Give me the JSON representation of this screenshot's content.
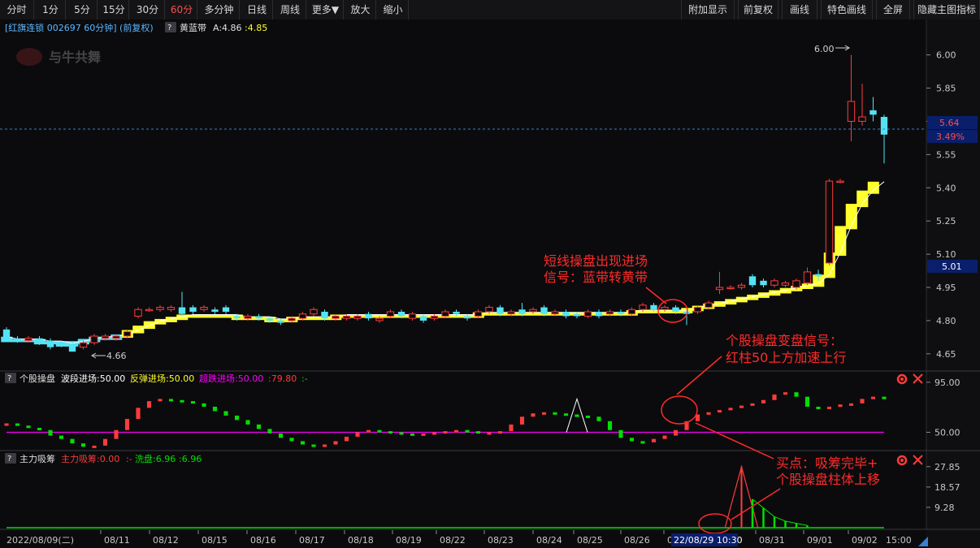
{
  "toolbar": {
    "left": [
      "分时",
      "1分",
      "5分",
      "15分",
      "30分",
      "60分",
      "多分钟",
      "日线",
      "周线",
      "更多▼",
      "放大",
      "缩小"
    ],
    "active": "60分",
    "right": [
      "附加显示",
      "前复权",
      "画线",
      "特色画线",
      "全屏",
      "隐藏主图指标"
    ]
  },
  "main_header": {
    "stock": "[红旗连锁 002697 60分钟] (前复权)",
    "question": "?",
    "indicator": "黄蓝带",
    "a_label": "A:4.86",
    "value": ":4.85"
  },
  "logo_text": "与牛共舞",
  "price_axis": {
    "ticks": [
      "6.00",
      "5.85",
      "5.70",
      "5.55",
      "5.40",
      "5.25",
      "5.10",
      "4.95",
      "4.80",
      "4.65"
    ],
    "current_price": "5.64",
    "current_change": "3.49%",
    "cursor_price": "5.01"
  },
  "annotations": {
    "high_label": "6.00",
    "low_label": "4.66",
    "note1_line1": "短线操盘出现进场",
    "note1_line2": "信号：蓝带转黄带",
    "note2_line1": "个股操盘变盘信号：",
    "note2_line2": "红柱50上方加速上行",
    "note3_line1": "买点：吸筹完毕+",
    "note3_line2": "个股操盘柱体上移"
  },
  "panel2": {
    "question": "?",
    "title": "个股操盘",
    "wave": "波段进场:50.00",
    "rebound": "反弹进场:50.00",
    "oversold": "超跌进场:50.00",
    "red_val": ":79.80",
    "dash": ":-",
    "ticks": [
      "95.00",
      "50.00"
    ]
  },
  "panel3": {
    "question": "?",
    "title": "主力吸筹",
    "main_label": "主力吸筹:0.00",
    "dash": ":-",
    "wash_label": "洗盘:6.96",
    "wash_val": ":6.96",
    "ticks": [
      "27.85",
      "18.57",
      "9.28"
    ]
  },
  "xaxis": {
    "labels": [
      "2022/08/09(二)",
      "08/11",
      "08/12",
      "08/15",
      "08/16",
      "08/17",
      "08/18",
      "08/19",
      "08/22",
      "08/23",
      "08/24",
      "08/25",
      "08/26",
      "0",
      "08/31",
      "09/01",
      "09/02",
      "15:00"
    ],
    "cursor_label": "22/08/29 10:30"
  },
  "colors": {
    "up": "#ff3b3b",
    "down": "#54e3f5",
    "yellow": "#ffff2b",
    "green": "#00e000",
    "magenta": "#ff00ff",
    "note": "#ff2a2a",
    "axis": "#c8c8c8"
  },
  "chart_data": {
    "type": "candlestick",
    "main_ylim": [
      4.62,
      6.05
    ],
    "candles": [
      [
        4.76,
        4.72,
        4.77,
        4.71
      ],
      [
        4.72,
        4.71,
        4.73,
        4.7
      ],
      [
        4.71,
        4.72,
        4.73,
        4.7
      ],
      [
        4.72,
        4.7,
        4.73,
        4.69
      ],
      [
        4.71,
        4.68,
        4.72,
        4.67
      ],
      [
        4.7,
        4.69,
        4.71,
        4.68
      ],
      [
        4.69,
        4.66,
        4.7,
        4.66
      ],
      [
        4.68,
        4.7,
        4.71,
        4.67
      ],
      [
        4.7,
        4.73,
        4.74,
        4.69
      ],
      [
        4.72,
        4.73,
        4.74,
        4.71
      ],
      [
        4.72,
        4.73,
        4.74,
        4.71
      ],
      [
        4.73,
        4.75,
        4.76,
        4.72
      ],
      [
        4.82,
        4.85,
        4.86,
        4.81
      ],
      [
        4.85,
        4.85,
        4.86,
        4.84
      ],
      [
        4.85,
        4.86,
        4.87,
        4.84
      ],
      [
        4.85,
        4.86,
        4.87,
        4.84
      ],
      [
        4.86,
        4.83,
        4.93,
        4.82
      ],
      [
        4.86,
        4.84,
        4.87,
        4.83
      ],
      [
        4.85,
        4.86,
        4.87,
        4.84
      ],
      [
        4.85,
        4.84,
        4.86,
        4.83
      ],
      [
        4.86,
        4.84,
        4.87,
        4.83
      ],
      [
        4.82,
        4.81,
        4.83,
        4.8
      ],
      [
        4.81,
        4.82,
        4.83,
        4.8
      ],
      [
        4.82,
        4.81,
        4.83,
        4.8
      ],
      [
        4.81,
        4.8,
        4.82,
        4.79
      ],
      [
        4.8,
        4.79,
        4.81,
        4.78
      ],
      [
        4.8,
        4.81,
        4.82,
        4.79
      ],
      [
        4.81,
        4.83,
        4.84,
        4.8
      ],
      [
        4.83,
        4.85,
        4.86,
        4.82
      ],
      [
        4.84,
        4.81,
        4.85,
        4.8
      ],
      [
        4.81,
        4.82,
        4.83,
        4.8
      ],
      [
        4.81,
        4.82,
        4.83,
        4.8
      ],
      [
        4.81,
        4.82,
        4.83,
        4.8
      ],
      [
        4.83,
        4.81,
        4.84,
        4.8
      ],
      [
        4.8,
        4.81,
        4.82,
        4.79
      ],
      [
        4.82,
        4.84,
        4.85,
        4.81
      ],
      [
        4.84,
        4.82,
        4.85,
        4.81
      ],
      [
        4.81,
        4.83,
        4.84,
        4.8
      ],
      [
        4.82,
        4.8,
        4.83,
        4.79
      ],
      [
        4.81,
        4.82,
        4.83,
        4.8
      ],
      [
        4.82,
        4.84,
        4.85,
        4.81
      ],
      [
        4.84,
        4.83,
        4.85,
        4.82
      ],
      [
        4.82,
        4.81,
        4.83,
        4.8
      ],
      [
        4.82,
        4.84,
        4.85,
        4.81
      ],
      [
        4.84,
        4.86,
        4.87,
        4.83
      ],
      [
        4.86,
        4.83,
        4.87,
        4.82
      ],
      [
        4.83,
        4.84,
        4.85,
        4.82
      ],
      [
        4.85,
        4.83,
        4.88,
        4.82
      ],
      [
        4.84,
        4.85,
        4.86,
        4.83
      ],
      [
        4.86,
        4.83,
        4.87,
        4.82
      ],
      [
        4.83,
        4.84,
        4.85,
        4.82
      ],
      [
        4.84,
        4.82,
        4.85,
        4.81
      ],
      [
        4.83,
        4.82,
        4.84,
        4.81
      ],
      [
        4.82,
        4.84,
        4.85,
        4.81
      ],
      [
        4.84,
        4.82,
        4.85,
        4.81
      ],
      [
        4.83,
        4.84,
        4.85,
        4.82
      ],
      [
        4.84,
        4.83,
        4.85,
        4.82
      ],
      [
        4.83,
        4.85,
        4.86,
        4.82
      ],
      [
        4.85,
        4.87,
        4.88,
        4.84
      ],
      [
        4.87,
        4.85,
        4.88,
        4.84
      ],
      [
        4.85,
        4.86,
        4.87,
        4.84
      ],
      [
        4.86,
        4.84,
        4.87,
        4.83
      ],
      [
        4.84,
        4.83,
        4.85,
        4.78
      ],
      [
        4.84,
        4.86,
        4.87,
        4.83
      ],
      [
        4.86,
        4.88,
        4.89,
        4.85
      ],
      [
        4.94,
        4.95,
        5.02,
        4.92
      ],
      [
        4.95,
        4.95,
        4.96,
        4.94
      ],
      [
        4.95,
        4.96,
        4.97,
        4.94
      ],
      [
        5.0,
        4.96,
        5.01,
        4.95
      ],
      [
        4.98,
        4.96,
        4.99,
        4.95
      ],
      [
        4.96,
        4.98,
        4.99,
        4.95
      ],
      [
        4.96,
        4.97,
        4.98,
        4.95
      ],
      [
        4.95,
        4.98,
        4.99,
        4.94
      ],
      [
        4.97,
        5.02,
        5.04,
        4.96
      ],
      [
        5.01,
        5.0,
        5.03,
        4.98
      ],
      [
        5.06,
        5.43,
        5.44,
        5.05
      ],
      [
        5.43,
        5.43,
        5.44,
        5.42
      ],
      [
        5.7,
        5.79,
        6.0,
        5.61
      ],
      [
        5.7,
        5.72,
        5.87,
        5.68
      ],
      [
        5.75,
        5.73,
        5.81,
        5.7
      ],
      [
        5.72,
        5.64,
        5.73,
        5.51
      ]
    ],
    "band": [
      4.72,
      4.71,
      4.71,
      4.71,
      4.7,
      4.7,
      4.69,
      4.7,
      4.71,
      4.72,
      4.72,
      4.73,
      4.75,
      4.77,
      4.79,
      4.8,
      4.81,
      4.82,
      4.82,
      4.82,
      4.82,
      4.82,
      4.81,
      4.81,
      4.81,
      4.8,
      4.8,
      4.81,
      4.81,
      4.81,
      4.81,
      4.82,
      4.82,
      4.82,
      4.82,
      4.82,
      4.82,
      4.82,
      4.82,
      4.82,
      4.82,
      4.82,
      4.82,
      4.82,
      4.83,
      4.83,
      4.83,
      4.83,
      4.83,
      4.83,
      4.83,
      4.83,
      4.83,
      4.83,
      4.83,
      4.83,
      4.83,
      4.83,
      4.84,
      4.84,
      4.84,
      4.84,
      4.84,
      4.85,
      4.86,
      4.87,
      4.88,
      4.89,
      4.9,
      4.91,
      4.92,
      4.93,
      4.94,
      4.95,
      4.96,
      5.0,
      5.1,
      5.22,
      5.32,
      5.38,
      5.42
    ],
    "band_colors": "first 11 blue, then yellow",
    "osc_ylim": [
      35,
      100
    ],
    "osc": [
      58,
      56,
      54,
      52,
      47,
      44,
      40,
      37,
      38,
      44,
      52,
      62,
      72,
      78,
      80,
      79,
      78,
      76,
      73,
      69,
      65,
      61,
      57,
      53,
      49,
      45,
      42,
      39,
      38,
      39,
      42,
      46,
      50,
      52,
      51,
      50,
      49,
      48,
      49,
      50,
      51,
      52,
      51,
      50,
      50,
      51,
      57,
      64,
      67,
      68,
      67,
      66,
      65,
      64,
      60,
      52,
      45,
      42,
      41,
      44,
      47,
      52,
      60,
      66,
      68,
      70,
      72,
      74,
      76,
      79,
      84,
      86,
      82,
      73,
      72,
      73,
      75,
      76,
      80,
      82,
      81
    ],
    "osc_special": {
      "11": "lines_triangle"
    },
    "accum_ylim": [
      0,
      30
    ],
    "accum_red_spike": {
      "index": 67,
      "value": 27.85
    },
    "accum_green": [
      {
        "index": 68,
        "value": 13
      },
      {
        "index": 69,
        "value": 9
      },
      {
        "index": 70,
        "value": 5
      },
      {
        "index": 71,
        "value": 3
      },
      {
        "index": 72,
        "value": 2
      },
      {
        "index": 73,
        "value": 1
      }
    ]
  }
}
